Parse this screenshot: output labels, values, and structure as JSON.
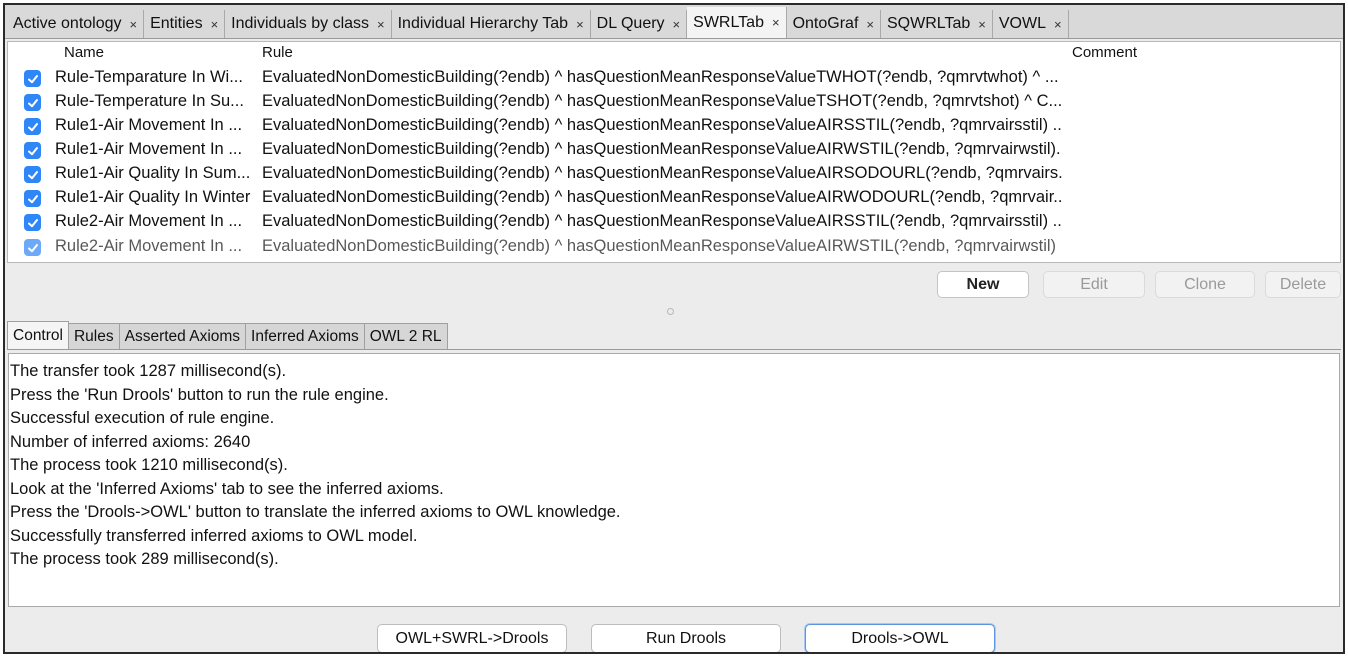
{
  "tabs": [
    {
      "label": "Active ontology",
      "close": "×"
    },
    {
      "label": "Entities",
      "close": "×"
    },
    {
      "label": "Individuals by class",
      "close": "×"
    },
    {
      "label": "Individual Hierarchy Tab",
      "close": "×"
    },
    {
      "label": "DL Query",
      "close": "×"
    },
    {
      "label": "SWRLTab",
      "close": "×",
      "active": true
    },
    {
      "label": "OntoGraf",
      "close": "×"
    },
    {
      "label": "SQWRLTab",
      "close": "×"
    },
    {
      "label": "VOWL",
      "close": "×"
    }
  ],
  "table": {
    "headers": {
      "name": "Name",
      "rule": "Rule",
      "comment": "Comment"
    },
    "rows": [
      {
        "enabled": true,
        "name": "Rule-Temparature In Wi...",
        "rule": "EvaluatedNonDomesticBuilding(?endb) ^ hasQuestionMeanResponseValueTWHOT(?endb, ?qmrvtwhot) ^ ..."
      },
      {
        "enabled": true,
        "name": "Rule-Temperature In Su...",
        "rule": "EvaluatedNonDomesticBuilding(?endb) ^ hasQuestionMeanResponseValueTSHOT(?endb, ?qmrvtshot) ^ C..."
      },
      {
        "enabled": true,
        "name": "Rule1-Air Movement In ...",
        "rule": "EvaluatedNonDomesticBuilding(?endb) ^ hasQuestionMeanResponseValueAIRSSTIL(?endb, ?qmrvairsstil) ..."
      },
      {
        "enabled": true,
        "name": "Rule1-Air Movement In ...",
        "rule": "EvaluatedNonDomesticBuilding(?endb) ^ hasQuestionMeanResponseValueAIRWSTIL(?endb, ?qmrvairwstil)..."
      },
      {
        "enabled": true,
        "name": "Rule1-Air Quality In Sum...",
        "rule": "EvaluatedNonDomesticBuilding(?endb) ^ hasQuestionMeanResponseValueAIRSODOURL(?endb, ?qmrvairs..."
      },
      {
        "enabled": true,
        "name": "Rule1-Air Quality In Winter",
        "rule": "EvaluatedNonDomesticBuilding(?endb) ^ hasQuestionMeanResponseValueAIRWODOURL(?endb, ?qmrvair..."
      },
      {
        "enabled": true,
        "name": "Rule2-Air Movement In ...",
        "rule": "EvaluatedNonDomesticBuilding(?endb) ^ hasQuestionMeanResponseValueAIRSSTIL(?endb, ?qmrvairsstil) ..."
      },
      {
        "enabled": true,
        "name": "Rule2-Air Movement In ...",
        "rule": "EvaluatedNonDomesticBuilding(?endb) ^ hasQuestionMeanResponseValueAIRWSTIL(?endb, ?qmrvairwstil)"
      }
    ]
  },
  "rule_buttons": {
    "new": "New",
    "edit": "Edit",
    "clone": "Clone",
    "delete": "Delete"
  },
  "subtabs": [
    {
      "label": "Control",
      "active": true
    },
    {
      "label": "Rules"
    },
    {
      "label": "Asserted Axioms"
    },
    {
      "label": "Inferred Axioms"
    },
    {
      "label": "OWL 2 RL"
    }
  ],
  "console_lines": [
    "The transfer took 1287 millisecond(s).",
    "Press the 'Run Drools' button to run the rule engine.",
    "Successful execution of rule engine.",
    "Number of inferred axioms: 2640",
    "The process took 1210 millisecond(s).",
    "Look at the 'Inferred Axioms' tab to see the inferred axioms.",
    "Press the 'Drools->OWL' button to translate the inferred axioms to OWL knowledge.",
    "Successfully transferred inferred axioms to OWL model.",
    "The process took 289 millisecond(s)."
  ],
  "control_buttons": {
    "owl_to_drools": "OWL+SWRL->Drools",
    "run_drools": "Run Drools",
    "drools_to_owl": "Drools->OWL"
  },
  "colors": {
    "checkbox": "#2f86f6",
    "focus": "#5b95e0"
  }
}
